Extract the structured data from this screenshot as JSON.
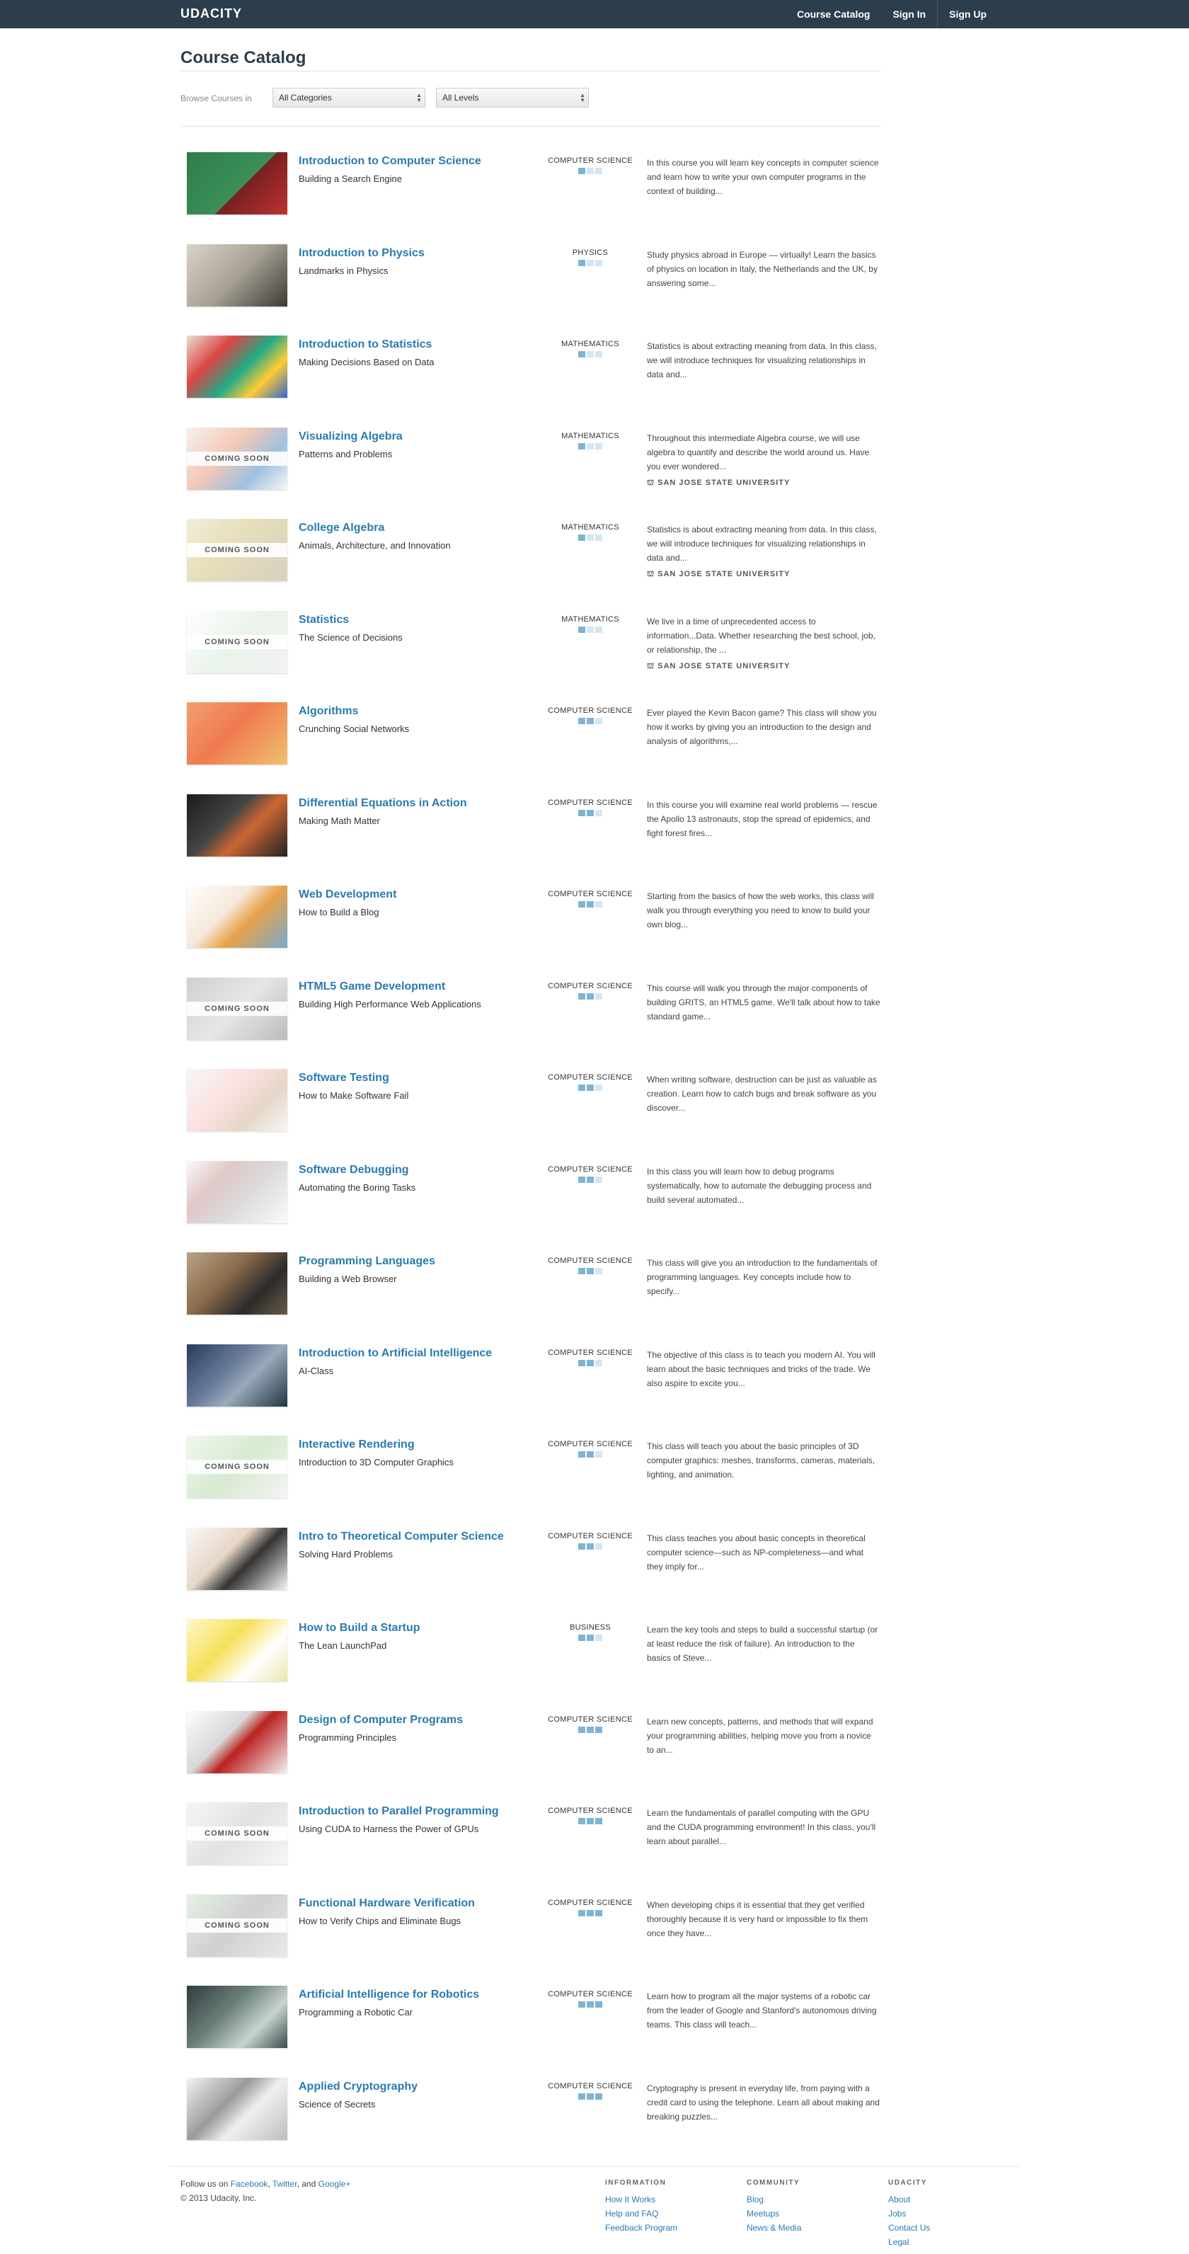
{
  "header": {
    "logo": "UDACITY",
    "nav": [
      {
        "label": "Course Catalog"
      },
      {
        "label": "Sign In"
      },
      {
        "label": "Sign Up"
      }
    ]
  },
  "catalog": {
    "title": "Course Catalog",
    "browse_label": "Browse Courses in",
    "category_select": "All Categories",
    "level_select": "All Levels"
  },
  "courses": [
    {
      "title": "Introduction to Computer Science",
      "subtitle": "Building a Search Engine",
      "category": "COMPUTER SCIENCE",
      "level": 1,
      "description": "In this course you will learn key concepts in computer science and learn how to write your own computer programs in the context of building...",
      "coming_soon": ""
    },
    {
      "title": "Introduction to Physics",
      "subtitle": "Landmarks in Physics",
      "category": "PHYSICS",
      "level": 1,
      "description": "Study physics abroad in Europe — virtually! Learn the basics of physics on location in Italy, the Netherlands and the UK, by answering some...",
      "coming_soon": ""
    },
    {
      "title": "Introduction to Statistics",
      "subtitle": "Making Decisions Based on Data",
      "category": "MATHEMATICS",
      "level": 1,
      "description": "Statistics is about extracting meaning from data. In this class, we will introduce techniques for visualizing relationships in data and...",
      "coming_soon": ""
    },
    {
      "title": "Visualizing Algebra",
      "subtitle": "Patterns and Problems",
      "category": "MATHEMATICS",
      "level": 1,
      "description": "Throughout this intermediate Algebra course, we will use algebra to quantify and describe the world around us. Have you ever wondered...",
      "coming_soon": "COMING SOON",
      "university": "SAN JOSE STATE UNIVERSITY"
    },
    {
      "title": "College Algebra",
      "subtitle": "Animals, Architecture, and Innovation",
      "category": "MATHEMATICS",
      "level": 1,
      "description": "Statistics is about extracting meaning from data. In this class, we will introduce techniques for visualizing relationships in data and...",
      "coming_soon": "COMING SOON",
      "university": "SAN JOSE STATE UNIVERSITY"
    },
    {
      "title": "Statistics",
      "subtitle": "The Science of Decisions",
      "category": "MATHEMATICS",
      "level": 1,
      "description": "We live in a time of unprecedented access to information...Data. Whether researching the best school, job, or relationship, the ...",
      "coming_soon": "COMING SOON",
      "university": "SAN JOSE STATE UNIVERSITY"
    },
    {
      "title": "Algorithms",
      "subtitle": "Crunching Social Networks",
      "category": "COMPUTER SCIENCE",
      "level": 2,
      "description": "Ever played the Kevin Bacon game? This class will show you how it works by giving you an introduction to the design and analysis of algorithms,...",
      "coming_soon": ""
    },
    {
      "title": "Differential Equations in Action",
      "subtitle": "Making Math Matter",
      "category": "COMPUTER SCIENCE",
      "level": 2,
      "description": "In this course you will examine real world problems — rescue the Apollo 13 astronauts, stop the spread of epidemics, and fight forest fires...",
      "coming_soon": ""
    },
    {
      "title": "Web Development",
      "subtitle": "How to Build a Blog",
      "category": "COMPUTER SCIENCE",
      "level": 2,
      "description": "Starting from the basics of how the web works, this class will walk you through everything you need to know to build your own blog...",
      "coming_soon": ""
    },
    {
      "title": "HTML5 Game Development",
      "subtitle": "Building High Performance Web Applications",
      "category": "COMPUTER SCIENCE",
      "level": 2,
      "description": "This course will walk you through the major components of building GRITS, an HTML5 game. We'll talk about how to take standard game...",
      "coming_soon": "COMING SOON"
    },
    {
      "title": "Software Testing",
      "subtitle": "How to Make Software Fail",
      "category": "COMPUTER SCIENCE",
      "level": 2,
      "description": "When writing software, destruction can be just as valuable as creation. Learn how to catch bugs and break software as you discover...",
      "coming_soon": ""
    },
    {
      "title": "Software Debugging",
      "subtitle": "Automating the Boring Tasks",
      "category": "COMPUTER SCIENCE",
      "level": 2,
      "description": "In this class you will learn how to debug programs systematically, how to automate the debugging process and build several automated...",
      "coming_soon": ""
    },
    {
      "title": "Programming Languages",
      "subtitle": "Building a Web Browser",
      "category": "COMPUTER SCIENCE",
      "level": 2,
      "description": "This class will give you an introduction to the fundamentals of programming languages. Key concepts include how to specify...",
      "coming_soon": ""
    },
    {
      "title": "Introduction to Artificial Intelligence",
      "subtitle": "AI-Class",
      "category": "COMPUTER SCIENCE",
      "level": 2,
      "description": "The objective of this class is to teach you modern AI. You will learn about the basic techniques and tricks of the trade. We also aspire to excite you...",
      "coming_soon": ""
    },
    {
      "title": "Interactive Rendering",
      "subtitle": "Introduction to 3D Computer Graphics",
      "category": "COMPUTER SCIENCE",
      "level": 2,
      "description": "This class will teach you about the basic principles of 3D computer graphics: meshes, transforms, cameras, materials, lighting, and animation.",
      "coming_soon": "COMING SOON"
    },
    {
      "title": "Intro to Theoretical Computer Science",
      "subtitle": "Solving Hard Problems",
      "category": "COMPUTER SCIENCE",
      "level": 2,
      "description": "This class teaches you about basic concepts in theoretical computer science—such as NP-completeness—and what they imply for...",
      "coming_soon": ""
    },
    {
      "title": "How to Build a Startup",
      "subtitle": "The Lean LaunchPad",
      "category": "BUSINESS",
      "level": 2,
      "description": "Learn the key tools and steps to build a successful startup (or at least reduce the risk of failure). An introduction to the basics of Steve...",
      "coming_soon": ""
    },
    {
      "title": "Design of Computer Programs",
      "subtitle": "Programming Principles",
      "category": "COMPUTER SCIENCE",
      "level": 3,
      "description": "Learn new concepts, patterns, and methods that will expand your programming abilities, helping move you from a novice to an...",
      "coming_soon": ""
    },
    {
      "title": "Introduction to Parallel Programming",
      "subtitle": "Using CUDA to Harness the Power of GPUs",
      "category": "COMPUTER SCIENCE",
      "level": 3,
      "description": "Learn the fundamentals of parallel computing with the GPU and the CUDA programming environment! In this class, you'll learn about parallel...",
      "coming_soon": "COMING SOON"
    },
    {
      "title": "Functional Hardware Verification",
      "subtitle": "How to Verify Chips and Eliminate Bugs",
      "category": "COMPUTER SCIENCE",
      "level": 3,
      "description": "When developing chips it is essential that they get verified thoroughly because it is very hard or impossible to fix them once they have...",
      "coming_soon": "COMING SOON"
    },
    {
      "title": "Artificial Intelligence for Robotics",
      "subtitle": "Programming a Robotic Car",
      "category": "COMPUTER SCIENCE",
      "level": 3,
      "description": "Learn how to program all the major systems of a robotic car from the leader of Google and Stanford's autonomous driving teams. This class will teach...",
      "coming_soon": ""
    },
    {
      "title": "Applied Cryptography",
      "subtitle": "Science of Secrets",
      "category": "COMPUTER SCIENCE",
      "level": 3,
      "description": "Cryptography is present in everyday life, from paying with a credit card to using the telephone. Learn all about making and breaking puzzles...",
      "coming_soon": ""
    }
  ],
  "footer": {
    "follow_prefix": "Follow us on",
    "follow_links": [
      "Facebook",
      "Twitter",
      "Google+"
    ],
    "follow_sep1": ",",
    "follow_sep2": ", and",
    "copyright": "© 2013 Udacity, Inc.",
    "columns": [
      {
        "heading": "INFORMATION",
        "links": [
          "How It Works",
          "Help and FAQ",
          "Feedback Program"
        ]
      },
      {
        "heading": "COMMUNITY",
        "links": [
          "Blog",
          "Meetups",
          "News & Media"
        ]
      },
      {
        "heading": "UDACITY",
        "links": [
          "About",
          "Jobs",
          "Contact Us",
          "Legal"
        ]
      }
    ]
  },
  "colors": {
    "topbar": "#2c3e4c",
    "link": "#2a7bb0",
    "level_on": "#7fb3d5",
    "level_off": "#d5e6f2"
  }
}
